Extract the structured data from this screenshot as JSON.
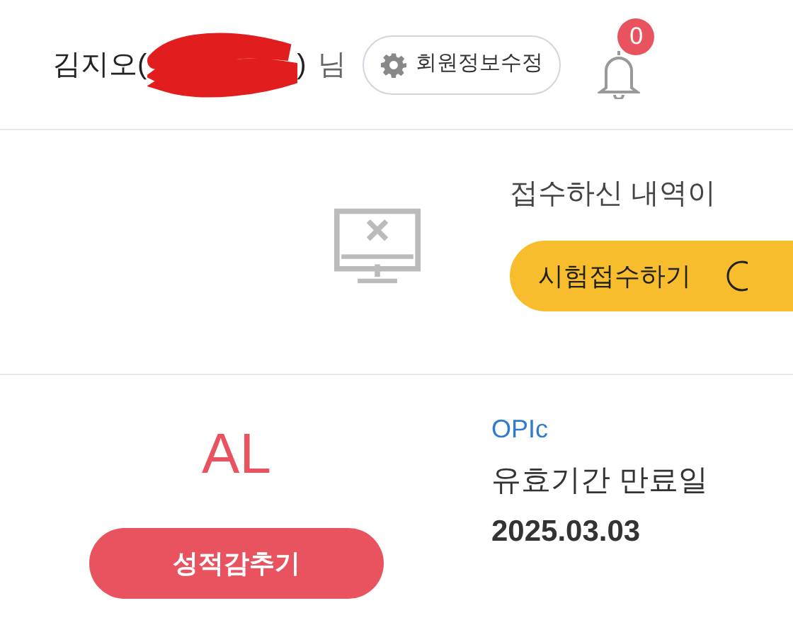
{
  "header": {
    "name_prefix": "김지오(",
    "name_suffix": ")",
    "honorific": "님",
    "edit_button": "회원정보수정",
    "notification_count": "0"
  },
  "empty_state": {
    "message": "접수하신 내역이",
    "apply_button": "시험접수하기"
  },
  "score": {
    "grade": "AL",
    "hide_button": "성적감추기",
    "test_name": "OPIc",
    "expiry_label": "유효기간 만료일",
    "expiry_date": "2025.03.03"
  }
}
